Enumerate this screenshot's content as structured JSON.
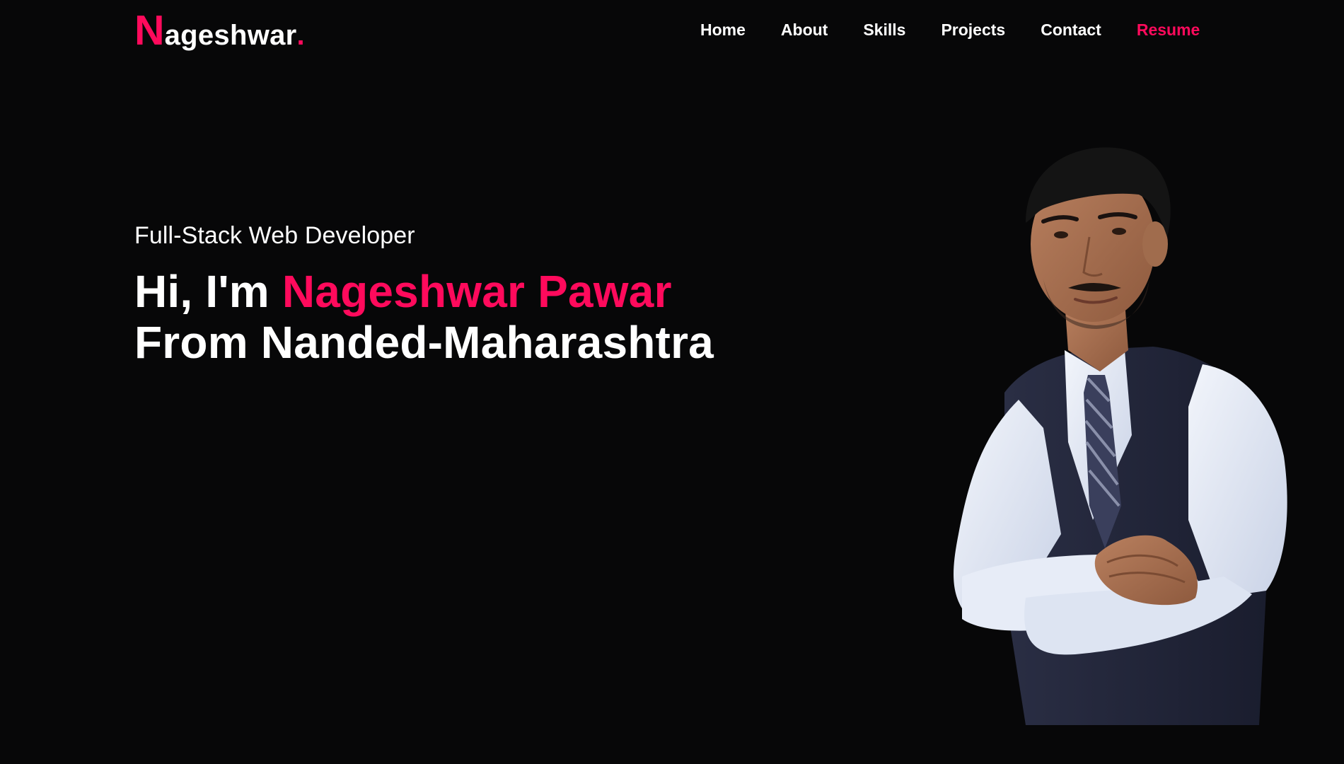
{
  "header": {
    "logo": {
      "initial": "N",
      "rest": "ageshwar",
      "dot": "."
    },
    "nav": [
      {
        "label": "Home"
      },
      {
        "label": "About"
      },
      {
        "label": "Skills"
      },
      {
        "label": "Projects"
      },
      {
        "label": "Contact"
      },
      {
        "label": "Resume"
      }
    ]
  },
  "hero": {
    "subtitle": "Full-Stack Web Developer",
    "title_prefix": "Hi, I'm ",
    "name": "Nageshwar Pawar",
    "title_line2": "From Nanded-Maharashtra"
  },
  "colors": {
    "background": "#070708",
    "accent": "#ff0a5c",
    "text": "#ffffff"
  },
  "images": {
    "portrait": "person-photo"
  }
}
